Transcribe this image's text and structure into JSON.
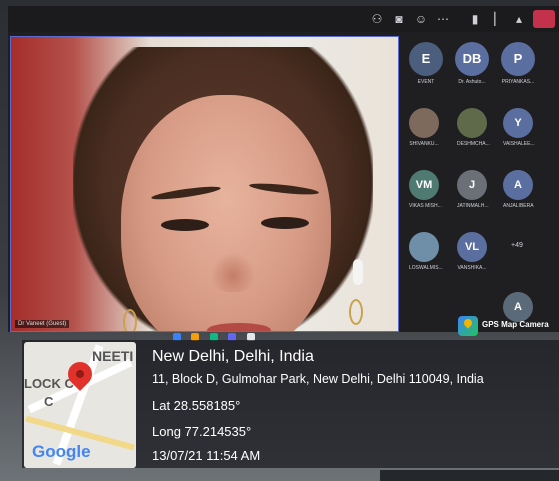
{
  "window": {
    "top_left_label": ""
  },
  "toolbar": {
    "icons": [
      "people-icon",
      "chat-icon",
      "reactions-icon",
      "more-icon",
      "camera-icon",
      "mic-icon",
      "share-icon",
      "leave-icon"
    ]
  },
  "main_video": {
    "participant_name": "Dr Vaneet (Guest)"
  },
  "roster": {
    "participants": [
      {
        "initials": "E",
        "name": "EVENT",
        "color": "#4b5e7e"
      },
      {
        "initials": "DB",
        "name": "Dr. Ashuto...",
        "color": "#5b6ea0"
      },
      {
        "initials": "P",
        "name": "PRIYANKAS...",
        "color": "#5b6ea0"
      },
      {
        "initials": "",
        "name": "SHIVANKU...",
        "color": "#7d6a5c"
      },
      {
        "initials": "",
        "name": "DESHMCHA...",
        "color": "#5e6a4a"
      },
      {
        "initials": "Y",
        "name": "VAISHALEE...",
        "color": "#5b6ea0"
      },
      {
        "initials": "VM",
        "name": "VIKAS MISH...",
        "color": "#4f7a72"
      },
      {
        "initials": "J",
        "name": "JATINMALH...",
        "color": "#6a6f78"
      },
      {
        "initials": "A",
        "name": "ANJALIBERA",
        "color": "#5b6ea0"
      },
      {
        "initials": "",
        "name": "LOSWALMIS...",
        "color": "#6f8fa8"
      },
      {
        "initials": "VL",
        "name": "VANSHIKA...",
        "color": "#5b6ea0"
      },
      {
        "initials": "A",
        "name": "",
        "color": "#5b6a78"
      }
    ],
    "more_count": "+49"
  },
  "gps_badge": {
    "label": "GPS Map Camera"
  },
  "overlay": {
    "map": {
      "area_label": "NEETI",
      "street_label": "LOCK C",
      "street_label2": "C",
      "logo": "Google"
    },
    "city": "New Delhi, Delhi, India",
    "address": "11, Block D, Gulmohar Park, New Delhi, Delhi 110049, India",
    "lat": "Lat 28.558185°",
    "long": "Long 77.214535°",
    "datetime": "13/07/21 11:54 AM"
  }
}
